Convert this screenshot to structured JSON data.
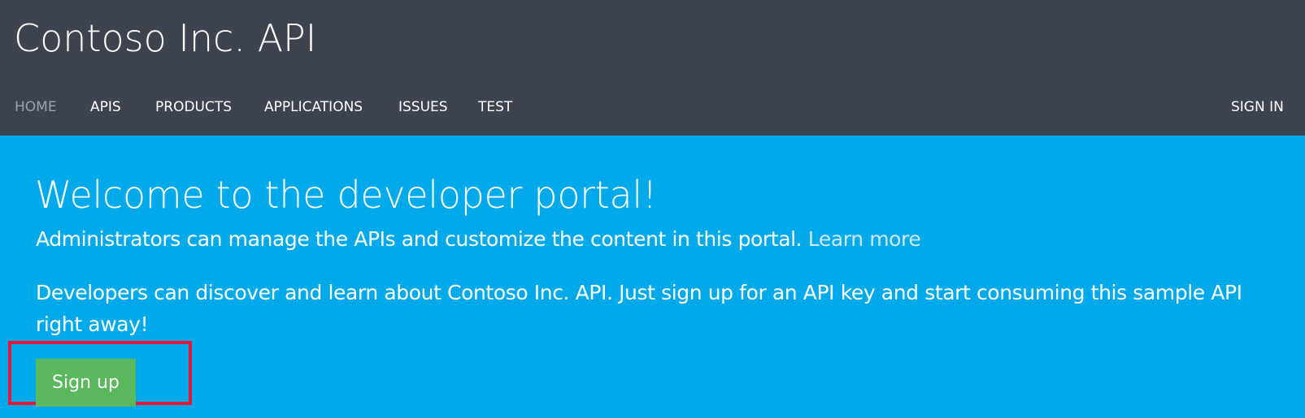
{
  "header": {
    "brand": "Contoso Inc. API",
    "background_color": "#3d4450"
  },
  "nav": {
    "items": [
      {
        "label": "HOME",
        "active": true
      },
      {
        "label": "APIS",
        "active": false
      },
      {
        "label": "PRODUCTS",
        "active": false
      },
      {
        "label": "APPLICATIONS",
        "active": false
      },
      {
        "label": "ISSUES",
        "active": false
      },
      {
        "label": "TEST",
        "active": false
      }
    ],
    "sign_in": "SIGN IN"
  },
  "hero": {
    "background_color": "#00aaea",
    "title": "Welcome to the developer portal!",
    "admin_text": "Administrators can manage the APIs and customize the content in this portal.",
    "learn_more": "Learn more",
    "developer_text": "Developers can discover and learn about Contoso Inc. API. Just sign up for an API key and start consuming this sample API right away!",
    "signup_label": "Sign up",
    "signup_color": "#5cb85c",
    "highlight_color": "#e3173c"
  }
}
